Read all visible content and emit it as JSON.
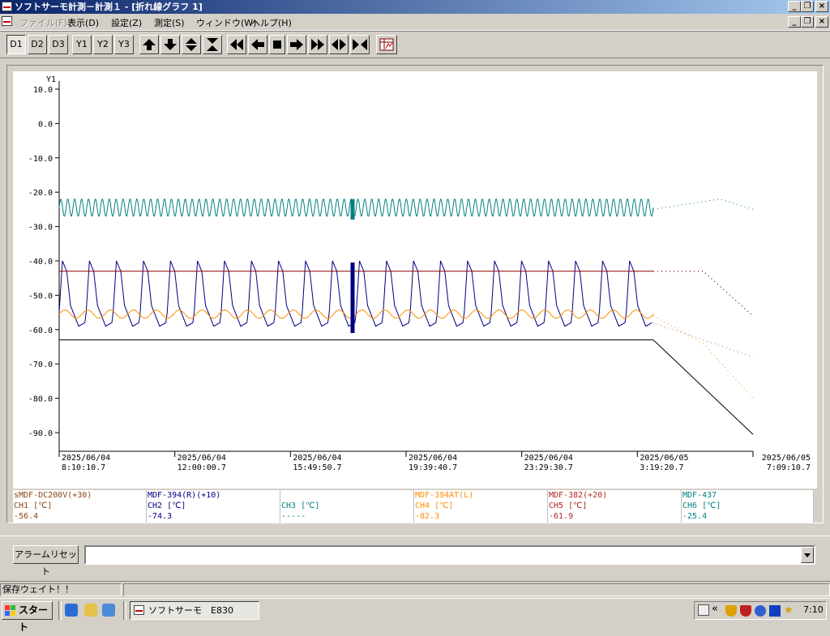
{
  "window": {
    "title": "ソフトサーモ計測－計測１ - [折れ線グラフ 1]",
    "buttons": [
      "_",
      "❐",
      "×"
    ]
  },
  "menu": [
    {
      "label": "ファイル(F)",
      "enabled": false
    },
    {
      "label": "表示(D)",
      "enabled": true
    },
    {
      "label": "設定(Z)",
      "enabled": true
    },
    {
      "label": "測定(S)",
      "enabled": true
    },
    {
      "label": "ウィンドウ(W)",
      "enabled": true
    },
    {
      "label": "ヘルプ(H)",
      "enabled": true
    }
  ],
  "toolbar": {
    "display_buttons": [
      "D1",
      "D2",
      "D3"
    ],
    "axis_buttons": [
      "Y1",
      "Y2",
      "Y3"
    ],
    "pressed": "D1",
    "arrow_icons": [
      "arrow-up-icon",
      "arrow-down-icon",
      "expand-vertical-icon",
      "collapse-vertical-icon"
    ],
    "nav_icons": [
      "rewind-icon",
      "step-back-icon",
      "stop-icon",
      "step-forward-icon",
      "fast-forward-icon",
      "expand-horizontal-icon",
      "collapse-horizontal-icon"
    ],
    "extra_icon": "table-icon"
  },
  "chart_data": {
    "type": "line",
    "ylabel": "Y1",
    "ylim": [
      -95,
      10
    ],
    "yticks": [
      "10.0",
      "0.0",
      "-10.0",
      "-20.0",
      "-30.0",
      "-40.0",
      "-50.0",
      "-60.0",
      "-70.0",
      "-80.0",
      "-90.0"
    ],
    "xticks": [
      {
        "date": "2025/06/04",
        "time": "8:10:10.7"
      },
      {
        "date": "2025/06/04",
        "time": "12:00:00.7"
      },
      {
        "date": "2025/06/04",
        "time": "15:49:50.7"
      },
      {
        "date": "2025/06/04",
        "time": "19:39:40.7"
      },
      {
        "date": "2025/06/04",
        "time": "23:29:30.7"
      },
      {
        "date": "2025/06/05",
        "time": "3:19:20.7"
      },
      {
        "date": "2025/06/05",
        "time": "7:09:10.7"
      }
    ],
    "grid": false,
    "series": [
      {
        "color": "#008080",
        "shape": "oscillation",
        "center": -24.5,
        "amplitude": 2.5,
        "cycles": 86,
        "trail": [
          -25.0,
          -23.5,
          -22.0,
          -25.0
        ]
      },
      {
        "color": "#000080",
        "shape": "sawtooth",
        "high": -43.0,
        "low": -59.0,
        "cycles": 22,
        "trail": [
          -43.0,
          -43.0,
          -56.0
        ]
      },
      {
        "color": "#ff8c00",
        "shape": "oscillation",
        "center": -55.5,
        "amplitude": 1.2,
        "cycles": 26,
        "trail": [
          -56.0,
          -64.0,
          -80.0
        ]
      },
      {
        "color": "#8b0000",
        "shape": "flat",
        "value": -43.0,
        "trail": [
          -43.0,
          -43.0,
          -56.0
        ]
      },
      {
        "color": "#000000",
        "shape": "flat",
        "value": -63.0,
        "trail": [
          -63.0,
          -90.5
        ]
      },
      {
        "color": "#808080",
        "shape": "dots",
        "trail": [
          -58.0,
          -68.0
        ]
      }
    ],
    "cursor": {
      "color": "#000080",
      "x_fraction": 0.5
    }
  },
  "legend": [
    {
      "name": "sMDF-DC200V(+30)",
      "channel": "CH1 [℃]",
      "value": "-56.4",
      "color": "#8b4513"
    },
    {
      "name": "MDF-394(R)(+10)",
      "channel": "CH2 [℃]",
      "value": "-74.3",
      "color": "#000080"
    },
    {
      "name": "",
      "channel": "CH3 [℃]",
      "value": "-----",
      "color": "#008080"
    },
    {
      "name": "MDF-394AT(L)",
      "channel": "CH4 [℃]",
      "value": "-82.3",
      "color": "#ff8c00"
    },
    {
      "name": "MDF-382(+20)",
      "channel": "CH5 [℃]",
      "value": "-61.9",
      "color": "#b22222"
    },
    {
      "name": "MDF-437",
      "channel": "CH6 [℃]",
      "value": "-25.4",
      "color": "#008080"
    }
  ],
  "alarm": {
    "reset_label": "アラームリセット",
    "combo_value": ""
  },
  "status": {
    "message": "保存ウェイト！！"
  },
  "taskbar": {
    "start_label": "スタート",
    "task_label": "ソフトサーモ　E830",
    "clock": "7:10",
    "tray_chevron": "«"
  }
}
